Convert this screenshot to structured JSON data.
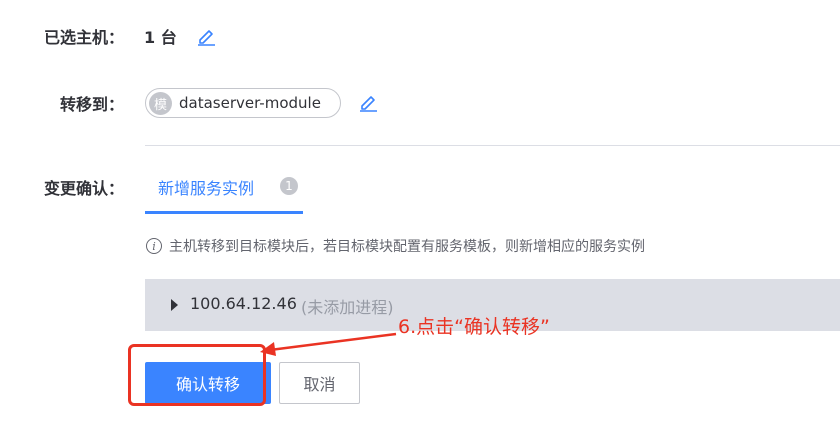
{
  "selected_hosts": {
    "label": "已选主机：",
    "count": "1 台",
    "edit_icon": "pencil-icon"
  },
  "transfer_to": {
    "label": "转移到：",
    "module_badge": "模",
    "module_name": "dataserver-module",
    "edit_icon": "pencil-icon"
  },
  "change_confirm": {
    "label": "变更确认：",
    "tabs": [
      {
        "label": "新增服务实例",
        "count": "1"
      }
    ],
    "tip_icon": "info-icon",
    "tip": "主机转移到目标模块后，若目标模块配置有服务模板，则新增相应的服务实例",
    "instances": [
      {
        "ip": "100.64.12.46",
        "note": "(未添加进程)"
      }
    ]
  },
  "annotation": {
    "text": "6.点击“确认转移”",
    "color": "#ea3323"
  },
  "actions": {
    "confirm": "确认转移",
    "cancel": "取消"
  },
  "colors": {
    "primary": "#3a84ff",
    "annotation": "#ea3323",
    "text": "#313238",
    "muted": "#979ba5"
  }
}
